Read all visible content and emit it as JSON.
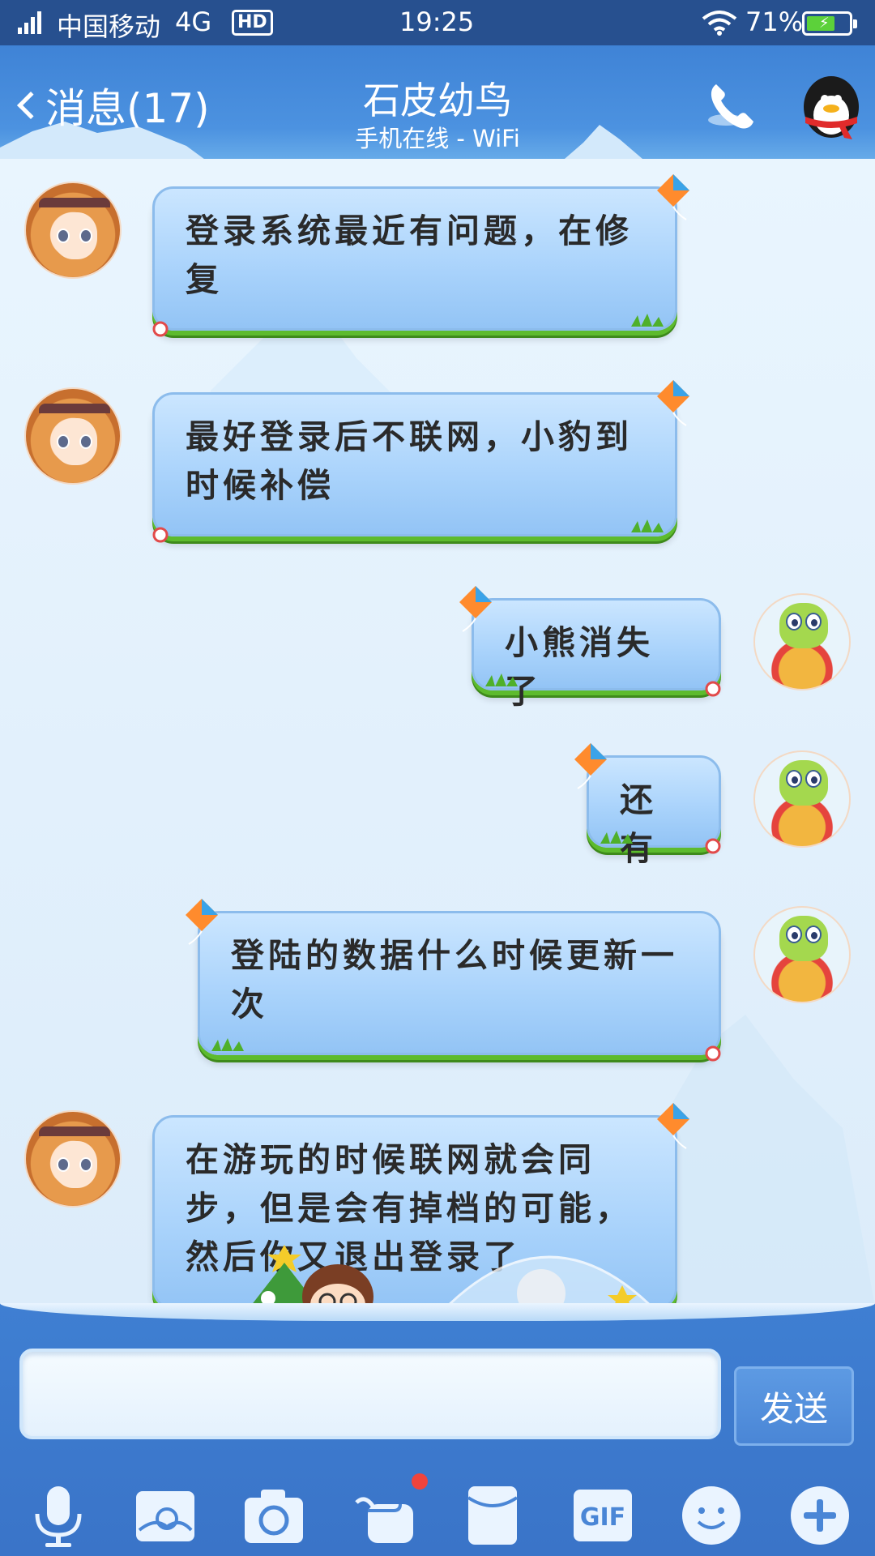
{
  "status_bar": {
    "carrier": "中国移动",
    "network": "4G",
    "hd": "HD",
    "time": "19:25",
    "battery_percent": "71%",
    "battery_level": 0.71
  },
  "header": {
    "back_label": "消息(17)",
    "title": "石皮幼鸟",
    "subtitle": "手机在线 - WiFi"
  },
  "messages": [
    {
      "side": "left",
      "text": "登录系统最近有问题，在修复"
    },
    {
      "side": "left",
      "text": "最好登录后不联网，小豹到时候补偿"
    },
    {
      "side": "right",
      "text": "小熊消失了"
    },
    {
      "side": "right",
      "text": "还有"
    },
    {
      "side": "right",
      "text": "登陆的数据什么时候更新一次"
    },
    {
      "side": "left",
      "text": "在游玩的时候联网就会同步，但是会有掉档的可能，然后你又退出登录了"
    }
  ],
  "input": {
    "value": "",
    "send_label": "发送"
  },
  "toolbar": {
    "items": [
      "microphone-icon",
      "photo-icon",
      "camera-icon",
      "red-packet-icon",
      "file-icon",
      "gif-icon",
      "emoji-icon",
      "plus-icon"
    ],
    "gif_label": "GIF"
  },
  "colors": {
    "header": "#3f83d6",
    "bubble": "#a8d2fb",
    "bubble_grass": "#5dbb2d",
    "input_bar": "#3f7fd2",
    "badge": "#f0443c"
  }
}
